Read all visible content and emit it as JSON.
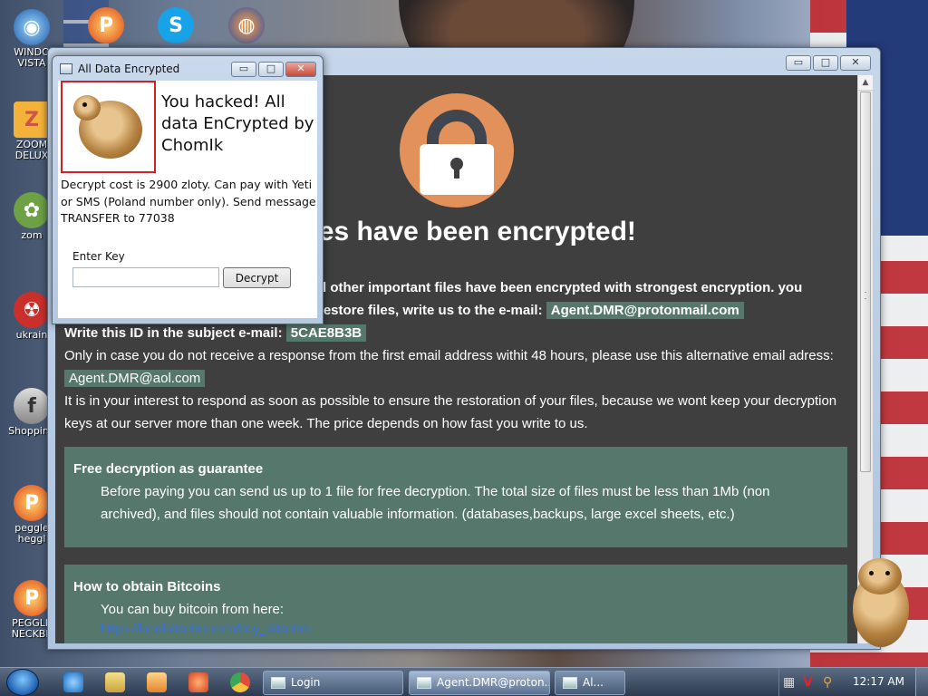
{
  "desktop": {
    "icons": [
      {
        "label": "WINDO\nVISTA",
        "icon": "vista-theme-icon"
      },
      {
        "label": "",
        "icon": "peggle-icon"
      },
      {
        "label": "",
        "icon": "skype-icon"
      },
      {
        "label": "",
        "icon": "globe-icon"
      },
      {
        "label": "ZOOM\nDELUX",
        "icon": "zoom-game-icon"
      },
      {
        "label": "zom",
        "icon": "flower-icon"
      },
      {
        "label": "ukrain",
        "icon": "radiation-icon"
      },
      {
        "label": "Shopping",
        "icon": "flash-icon"
      },
      {
        "label": "peggle\nheggl",
        "icon": "peggle-icon"
      },
      {
        "label": "PEGGLE\nNECKBE",
        "icon": "peggle-icon"
      }
    ]
  },
  "main_window": {
    "controls": {
      "minimize": "▭",
      "maximize": "□",
      "close": "✕"
    },
    "headline": "r files have been encrypted!",
    "line1_bold": "d other important files have been encrypted with strongest encryption. you",
    "line2_bold": "restore files, write us to the e-mail:",
    "email_primary": "Agent.DMR@protonmail.com",
    "id_label": "Write this ID in the subject e-mail:",
    "id_value": "5CAE8B3B",
    "alt_text": "Only in case you do not receive a response from the first email address withit 48 hours, please use this alternative email adress:",
    "email_alt": "Agent.DMR@aol.com",
    "interest_text": "It is in your interest to respond as soon as possible to ensure the restoration of your files, because we wont keep your decryption keys at our server more than one week. The price depends on how fast you write to us.",
    "panel1": {
      "title": "Free decryption as guarantee",
      "text": "Before paying you can send us up to 1 file for free decryption. The total size of files must be less than 1Mb (non archived), and files should not contain valuable information. (databases,backups, large excel sheets, etc.)"
    },
    "panel2": {
      "title": "How to obtain Bitcoins",
      "text": "You can buy bitcoin from here:",
      "link": "https://localbitcoins.com/buy_bitcoins"
    }
  },
  "small_window": {
    "title": "All Data Encrypted",
    "hacked_text": "You hacked! All data EnCrypted by ChomIk",
    "cost_text": "Decrypt cost is 2900 zloty. Can pay with Yeti or SMS (Poland number only). Send message TRANSFER to 77038",
    "key_label": "Enter Key",
    "key_value": "",
    "decrypt_label": "Decrypt",
    "controls": {
      "minimize": "▭",
      "maximize": "□",
      "close": "✕"
    }
  },
  "taskbar": {
    "tasks": [
      {
        "label": "Login",
        "active": false
      },
      {
        "label": "Agent.DMR@proton...",
        "active": true
      },
      {
        "label": "Al...",
        "active": false
      }
    ],
    "clock": "12:17 AM"
  },
  "colors": {
    "main_bg": "#3f3f3f",
    "panel_bg": "#56776b",
    "lock_circle": "#e3915a",
    "link": "#3a6fd8"
  }
}
